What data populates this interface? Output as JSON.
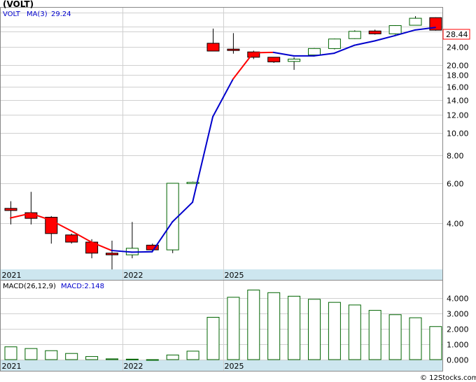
{
  "header": {
    "symbol": "(VOLT)",
    "ticker": "VOLT",
    "ma_label": "MA(3)",
    "ma_value": "29.24",
    "last_price_tag": "28.44"
  },
  "macd_header": {
    "label": "MACD(26,12,9)",
    "value_label": "MACD:2.148"
  },
  "footer": {
    "watermark": "© 12Stocks.com"
  },
  "colors": {
    "up_candle": "#006400",
    "down_candle": "#ff0000",
    "ma_line_falling": "#ff0000",
    "ma_line_rising": "#0000cc",
    "macd_bar": "#006400",
    "axis_band": "#cde6ef",
    "grid": "#d0d0d0"
  },
  "chart_data": [
    {
      "type": "candlestick",
      "title": "(VOLT)",
      "scale": "log",
      "grid": true,
      "y_ticks": [
        4.0,
        6.0,
        8.0,
        10.0,
        12.0,
        14.0,
        16.0,
        18.0,
        20.0,
        24.0,
        28.0
      ],
      "y_tick_labels": [
        "4.00",
        "6.00",
        "8.00",
        "10.00",
        "12.00",
        "14.00",
        "16.00",
        "18.00",
        "20.00",
        "24.00",
        "28.00"
      ],
      "x_labels": [
        {
          "label": "2021",
          "index": 0
        },
        {
          "label": "2022",
          "index": 6
        },
        {
          "label": "2025",
          "index": 11
        }
      ],
      "ylim": [
        2.0,
        42.0
      ],
      "candles": [
        {
          "open": 4.65,
          "high": 5.0,
          "low": 3.95,
          "close": 4.55
        },
        {
          "open": 4.45,
          "high": 5.5,
          "low": 3.95,
          "close": 4.2
        },
        {
          "open": 4.25,
          "high": 4.3,
          "low": 3.25,
          "close": 3.6
        },
        {
          "open": 3.55,
          "high": 3.6,
          "low": 3.25,
          "close": 3.3
        },
        {
          "open": 3.3,
          "high": 3.4,
          "low": 2.8,
          "close": 2.95
        },
        {
          "open": 2.95,
          "high": 3.35,
          "low": 2.5,
          "close": 2.9
        },
        {
          "open": 2.9,
          "high": 4.05,
          "low": 2.8,
          "close": 3.1
        },
        {
          "open": 3.2,
          "high": 3.25,
          "low": 3.0,
          "close": 3.05
        },
        {
          "open": 3.05,
          "high": 6.0,
          "low": 2.95,
          "close": 6.0
        },
        {
          "open": 6.0,
          "high": 6.1,
          "low": 6.0,
          "close": 6.02
        },
        {
          "open": 24.9,
          "high": 28.9,
          "low": 23.0,
          "close": 23.0
        },
        {
          "open": 23.3,
          "high": 27.6,
          "low": 22.4,
          "close": 23.1
        },
        {
          "open": 22.8,
          "high": 23.1,
          "low": 21.2,
          "close": 21.6
        },
        {
          "open": 21.6,
          "high": 21.6,
          "low": 20.4,
          "close": 20.6
        },
        {
          "open": 20.7,
          "high": 21.6,
          "low": 19.0,
          "close": 21.2
        },
        {
          "open": 22.1,
          "high": 23.7,
          "low": 22.0,
          "close": 23.6
        },
        {
          "open": 23.6,
          "high": 26.1,
          "low": 23.4,
          "close": 26.0
        },
        {
          "open": 26.1,
          "high": 28.4,
          "low": 26.0,
          "close": 28.1
        },
        {
          "open": 28.2,
          "high": 28.6,
          "low": 27.2,
          "close": 27.4
        },
        {
          "open": 27.4,
          "high": 29.9,
          "low": 27.2,
          "close": 29.8
        },
        {
          "open": 29.9,
          "high": 32.8,
          "low": 29.8,
          "close": 32.1
        },
        {
          "open": 32.3,
          "high": 32.4,
          "low": 28.3,
          "close": 28.44
        }
      ],
      "ma": {
        "name": "MA(3)",
        "values": [
          4.22,
          4.42,
          4.12,
          3.7,
          3.3,
          3.03,
          2.98,
          2.99,
          4.05,
          4.95,
          11.8,
          17.3,
          22.6,
          22.7,
          21.9,
          21.9,
          22.5,
          24.4,
          25.5,
          26.9,
          28.5,
          29.24
        ],
        "trend": [
          "down",
          "down",
          "down",
          "down",
          "down",
          "down",
          "up",
          "up",
          "up",
          "up",
          "up",
          "up",
          "down",
          "down",
          "up",
          "up",
          "up",
          "up",
          "up",
          "up",
          "up",
          "up"
        ]
      }
    },
    {
      "type": "bar",
      "title": "MACD(26,12,9)",
      "ylim": [
        -0.2,
        5.0
      ],
      "y_ticks": [
        0.0,
        1.0,
        2.0,
        3.0,
        4.0
      ],
      "y_tick_labels": [
        "0.000",
        "1.000",
        "2.000",
        "3.000",
        "4.000"
      ],
      "x_labels": [
        {
          "label": "2021",
          "index": 0
        },
        {
          "label": "2022",
          "index": 6
        },
        {
          "label": "2025",
          "index": 11
        }
      ],
      "values": [
        0.83,
        0.72,
        0.58,
        0.4,
        0.2,
        0.05,
        0.03,
        0.0,
        0.3,
        0.55,
        2.75,
        4.05,
        4.52,
        4.35,
        4.12,
        3.92,
        3.72,
        3.55,
        3.2,
        2.92,
        2.72,
        2.148
      ]
    }
  ]
}
